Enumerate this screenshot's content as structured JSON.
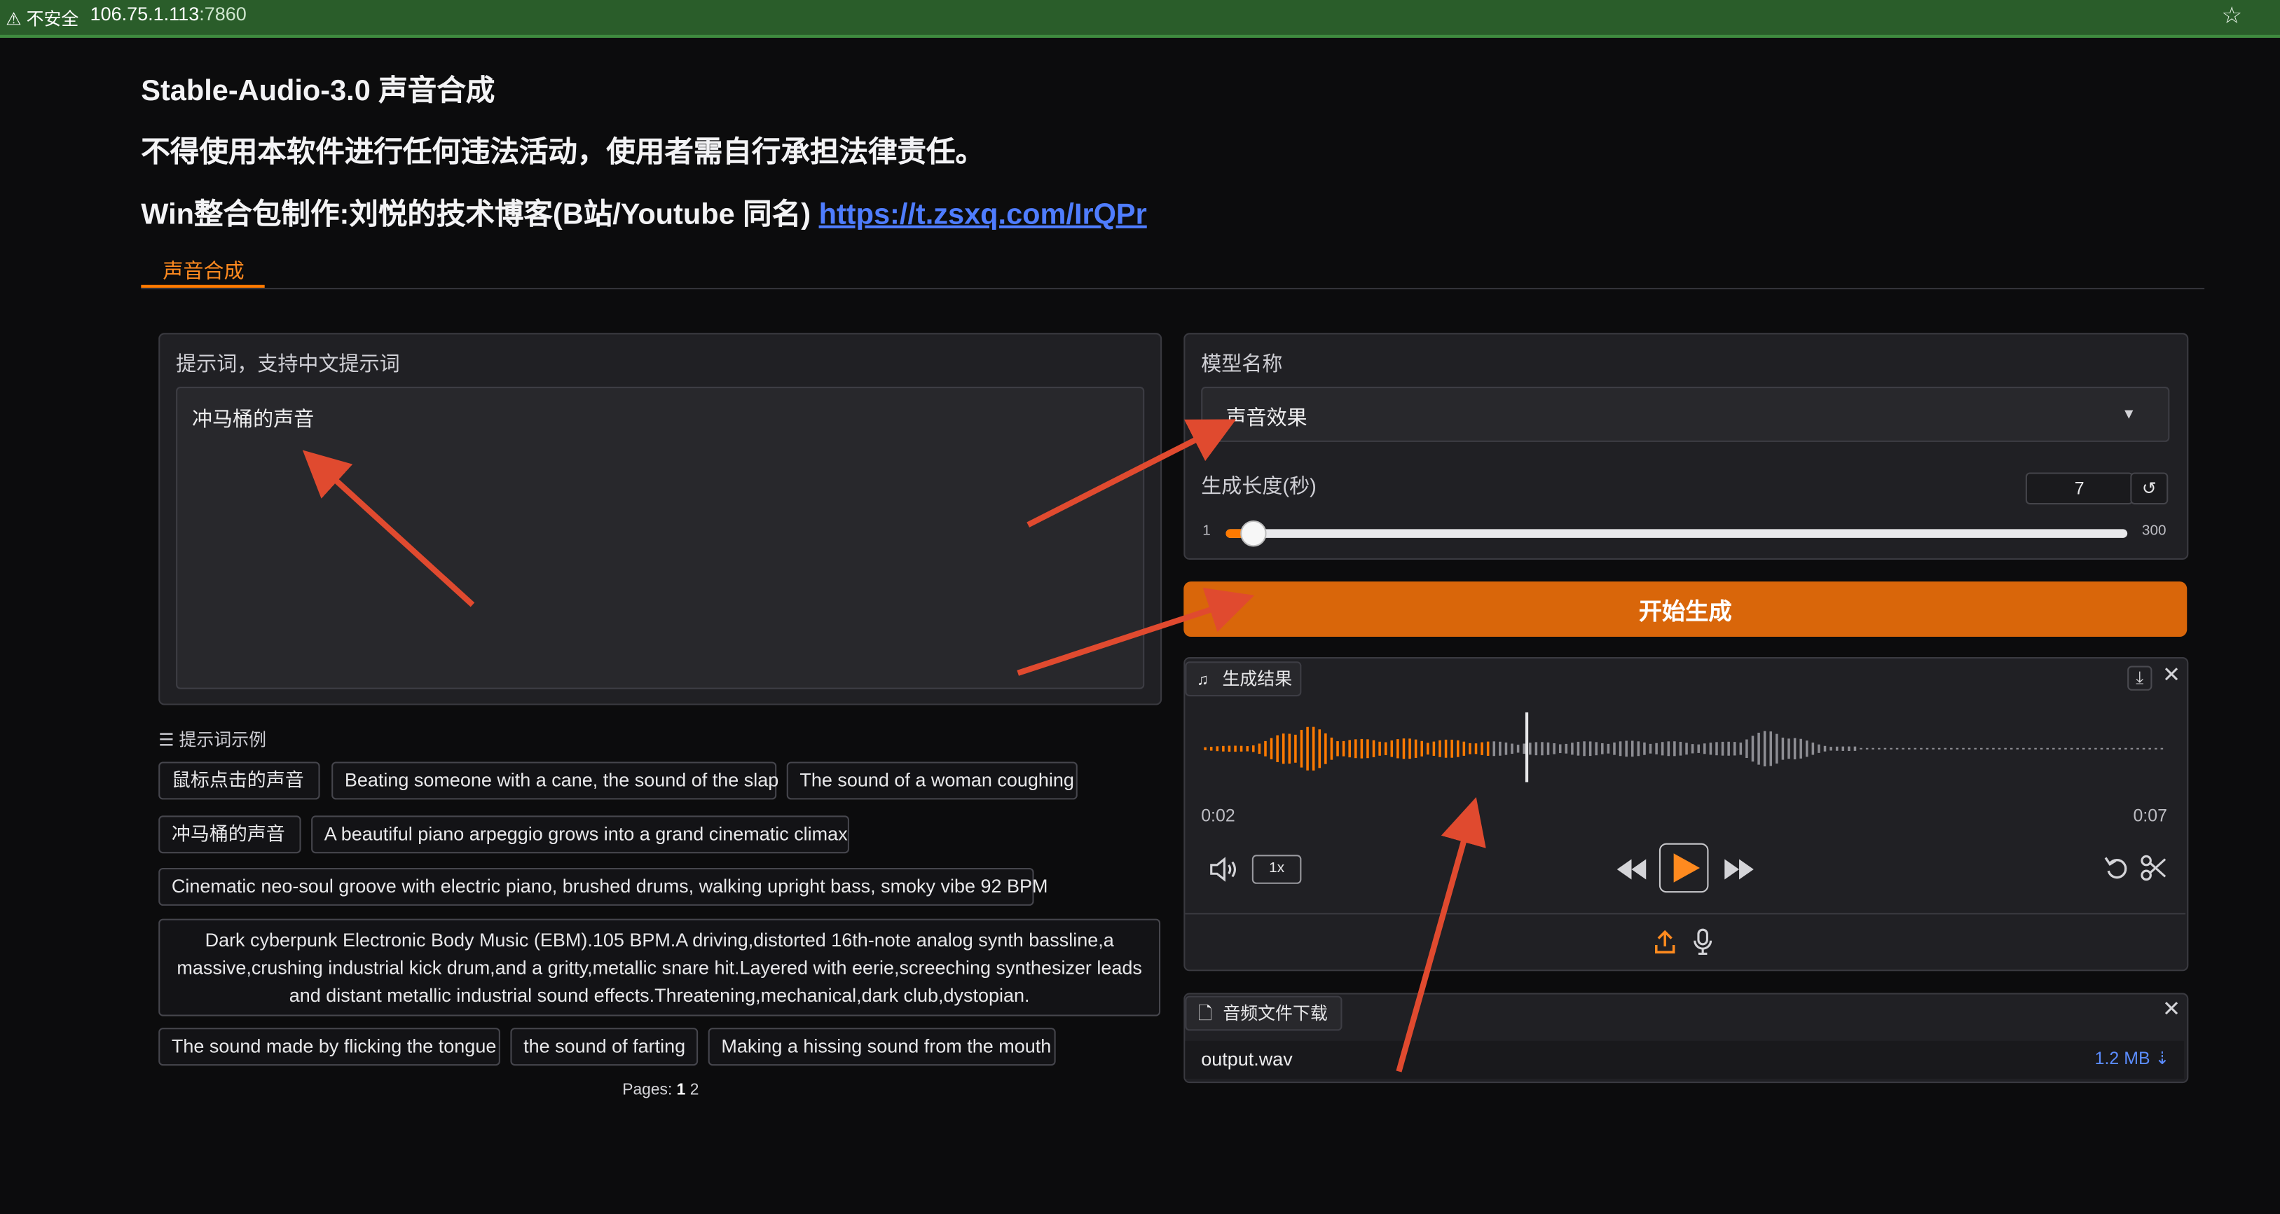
{
  "browser": {
    "security_label": "不安全",
    "host": "106.75.1.113",
    "port": ":7860"
  },
  "header": {
    "title": "Stable-Audio-3.0 声音合成",
    "disclaimer": "不得使用本软件进行任何违法活动，使用者需自行承担法律责任。",
    "credit_text": "Win整合包制作:刘悦的技术博客(B站/Youtube 同名)",
    "credit_link": "https://t.zsxq.com/IrQPr"
  },
  "tabs": [
    {
      "label": "声音合成",
      "active": true
    }
  ],
  "prompt": {
    "label": "提示词，支持中文提示词",
    "value": "冲马桶的声音"
  },
  "examples": {
    "label": "提示词示例",
    "items": [
      "鼠标点击的声音",
      "Beating someone with a cane, the sound of the slap",
      "The sound of a woman coughing",
      "冲马桶的声音",
      "A beautiful piano arpeggio grows into a grand cinematic climax",
      "Cinematic neo-soul groove with electric piano, brushed drums, walking upright bass, smoky vibe 92 BPM",
      "Dark cyberpunk Electronic Body Music (EBM).105 BPM.A driving,distorted 16th-note analog synth bassline,a massive,crushing industrial kick drum,and a gritty,metallic snare hit.Layered with eerie,screeching synthesizer leads and distant metallic industrial sound effects.Threatening,mechanical,dark club,dystopian.",
      "The sound made by flicking the tongue",
      "the sound of farting",
      "Making a hissing sound from the mouth"
    ],
    "pages_label": "Pages:",
    "pages": [
      "1",
      "2"
    ]
  },
  "model": {
    "label": "模型名称",
    "value": "声音效果"
  },
  "duration": {
    "label": "生成长度(秒)",
    "value": "7",
    "min": "1",
    "max": "300",
    "numeric_value": 7
  },
  "generate_button": "开始生成",
  "result": {
    "label": "生成结果",
    "time_current": "0:02",
    "time_total": "0:07",
    "playback_rate": "1x",
    "progress_fraction": 0.3
  },
  "download": {
    "label": "音频文件下载",
    "filename": "output.wav",
    "size": "1.2 MB ⇣"
  },
  "colors": {
    "accent": "#ff7a00",
    "link": "#4f7dff",
    "annotation_arrow": "#e04a2f"
  }
}
